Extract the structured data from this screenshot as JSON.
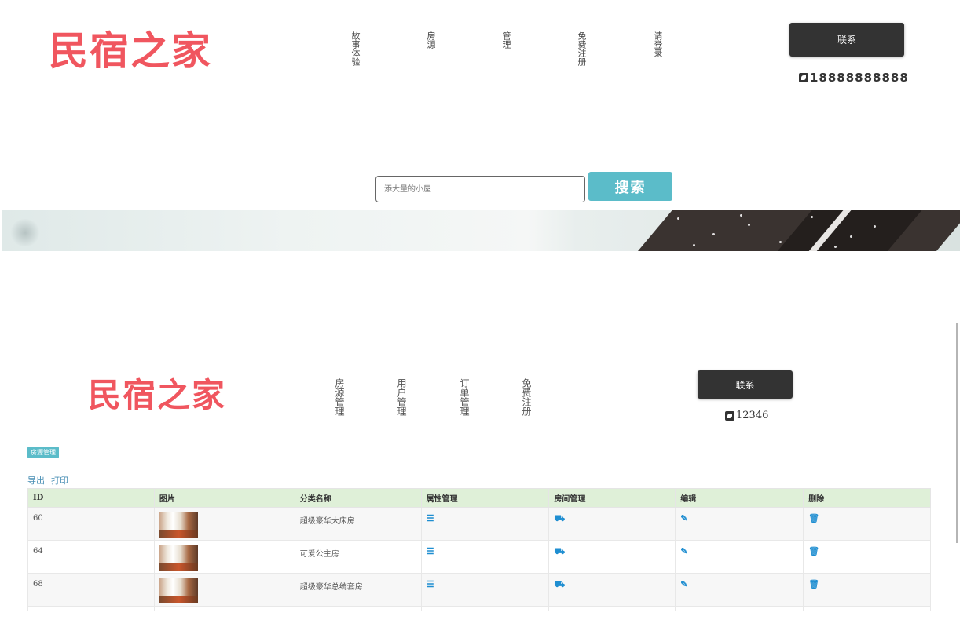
{
  "site": {
    "logo": "民宿之家",
    "nav": [
      "故事体验",
      "房源",
      "管理",
      "免费注册",
      "请登录"
    ],
    "contact_label": "联系",
    "phone": "18888888888",
    "search": {
      "placeholder": "添大量的小屋",
      "button": "搜索"
    }
  },
  "admin": {
    "logo": "民宿之家",
    "nav": [
      "房源管理",
      "用户管理",
      "订单管理",
      "免费注册"
    ],
    "contact_label": "联系",
    "phone": "12346",
    "section_badge": "房源管理",
    "tools": [
      "导出",
      "打印"
    ],
    "table": {
      "headers": [
        "ID",
        "图片",
        "分类名称",
        "属性管理",
        "房间管理",
        "编辑",
        "删除"
      ],
      "rows": [
        {
          "id": "60",
          "name": "超级豪华大床房"
        },
        {
          "id": "64",
          "name": "可爱公主房"
        },
        {
          "id": "68",
          "name": "超级豪华总统套房"
        }
      ]
    }
  },
  "icons": {
    "attribute": "list-icon",
    "room": "cart-icon",
    "edit": "edit-icon",
    "delete": "trash-icon",
    "phone": "phone-icon"
  },
  "colors": {
    "logo": "#f0565f",
    "accent": "#5bbcc9",
    "header_row": "#dff0d8",
    "icon_blue": "#1f8ed1",
    "dark_button": "#333333"
  }
}
